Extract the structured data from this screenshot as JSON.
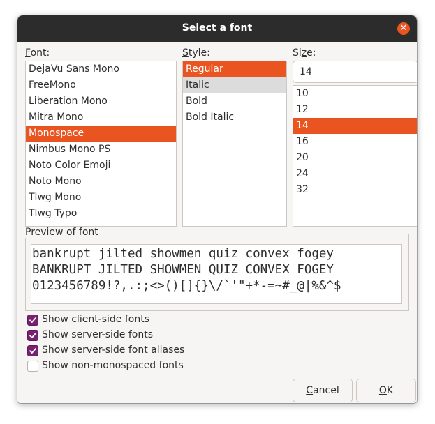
{
  "dialog": {
    "title": "Select a font",
    "close_icon": "close-icon",
    "accent_color": "#e95420"
  },
  "font": {
    "label_mnemonic": "F",
    "label_rest": "ont:",
    "items": [
      "DejaVu Sans Mono",
      "FreeMono",
      "Liberation Mono",
      "Mitra Mono",
      "Monospace",
      "Nimbus Mono PS",
      "Noto Color Emoji",
      "Noto Mono",
      "Tlwg Mono",
      "Tlwg Typo"
    ],
    "selected": "Monospace"
  },
  "style": {
    "label_mnemonic": "S",
    "label_rest": "tyle:",
    "items": [
      "Regular",
      "Italic",
      "Bold",
      "Bold Italic"
    ],
    "selected": "Regular",
    "hovered": "Italic"
  },
  "size": {
    "label_mnemonic": "z",
    "label_pre": "Si",
    "label_rest": "e:",
    "value": "14",
    "items": [
      "10",
      "12",
      "14",
      "16",
      "20",
      "24",
      "32"
    ],
    "selected": "14"
  },
  "preview": {
    "label": "Preview of font",
    "lines": [
      "bankrupt jilted showmen quiz convex fogey",
      "BANKRUPT JILTED SHOWMEN QUIZ CONVEX FOGEY",
      "0123456789!?,.:;<>()[]{}\\/`'\"+*-=~#_@|%&^$"
    ]
  },
  "options": [
    {
      "label": "Show client-side fonts",
      "checked": true
    },
    {
      "label": "Show server-side fonts",
      "checked": true
    },
    {
      "label": "Show server-side font aliases",
      "checked": true
    },
    {
      "label": "Show non-monospaced fonts",
      "checked": false
    }
  ],
  "buttons": {
    "cancel_mnemonic": "C",
    "cancel_rest": "ancel",
    "ok_mnemonic": "O",
    "ok_rest": "K"
  },
  "colors": {
    "checkbox_on": "#77216f",
    "titlebar": "#2c2c2c"
  }
}
